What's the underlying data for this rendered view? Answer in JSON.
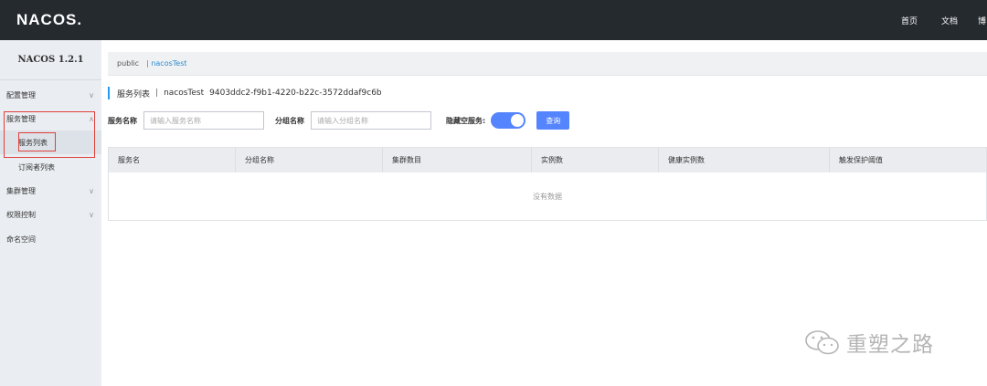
{
  "header": {
    "logo": "NACOS.",
    "nav": [
      "首页",
      "文档",
      "博"
    ]
  },
  "sidebar": {
    "version": "NACOS 1.2.1",
    "items": [
      {
        "label": "配置管理",
        "chevron": "chevron-down-icon"
      },
      {
        "label": "服务管理",
        "chevron": "chevron-up-icon"
      },
      {
        "label": "服务列表"
      },
      {
        "label": "订阅者列表"
      },
      {
        "label": "集群管理",
        "chevron": "chevron-down-icon"
      },
      {
        "label": "权限控制",
        "chevron": "chevron-down-icon"
      },
      {
        "label": "命名空间"
      }
    ]
  },
  "namespace_bar": {
    "public": "public",
    "selected": "| nacosTest"
  },
  "page": {
    "title": "服务列表",
    "namespace": "nacosTest",
    "namespace_id": "9403ddc2-f9b1-4220-b22c-3572ddaf9c6b"
  },
  "filters": {
    "service_name_label": "服务名称",
    "service_name_placeholder": "请输入服务名称",
    "group_name_label": "分组名称",
    "group_name_placeholder": "请输入分组名称",
    "hide_empty_label": "隐藏空服务:",
    "hide_empty_on": true,
    "query_button": "查询"
  },
  "table": {
    "columns": [
      "服务名",
      "分组名称",
      "集群数目",
      "实例数",
      "健康实例数",
      "触发保护阈值"
    ],
    "empty_text": "没有数据"
  },
  "watermark": {
    "text": "重塑之路"
  },
  "colors": {
    "topbar": "#252a2f",
    "primary": "#5584ff",
    "highlight": "#e0403a"
  }
}
